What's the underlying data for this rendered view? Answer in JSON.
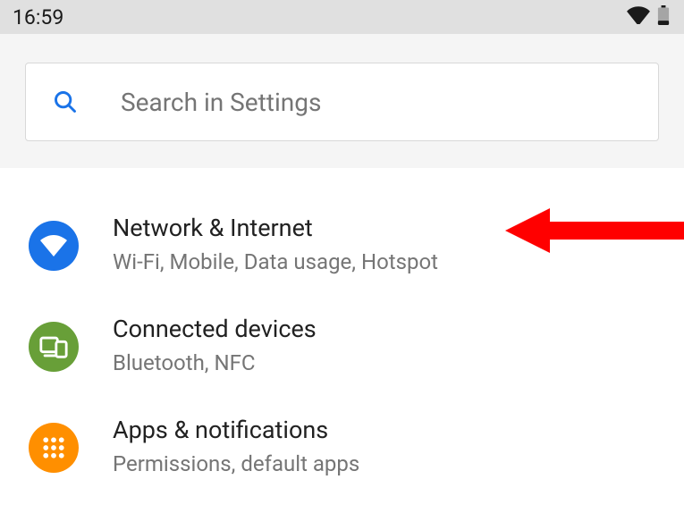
{
  "status_bar": {
    "time": "16:59"
  },
  "search": {
    "placeholder": "Search in Settings"
  },
  "settings": {
    "items": [
      {
        "title": "Network & Internet",
        "subtitle": "Wi-Fi, Mobile, Data usage, Hotspot",
        "icon": "wifi-icon",
        "color": "#1a73e8"
      },
      {
        "title": "Connected devices",
        "subtitle": "Bluetooth, NFC",
        "icon": "devices-icon",
        "color": "#689f38"
      },
      {
        "title": "Apps & notifications",
        "subtitle": "Permissions, default apps",
        "icon": "apps-grid-icon",
        "color": "#ff8f00"
      }
    ]
  },
  "annotation": {
    "type": "arrow",
    "points_to": "Network & Internet",
    "color": "#ff0000"
  }
}
